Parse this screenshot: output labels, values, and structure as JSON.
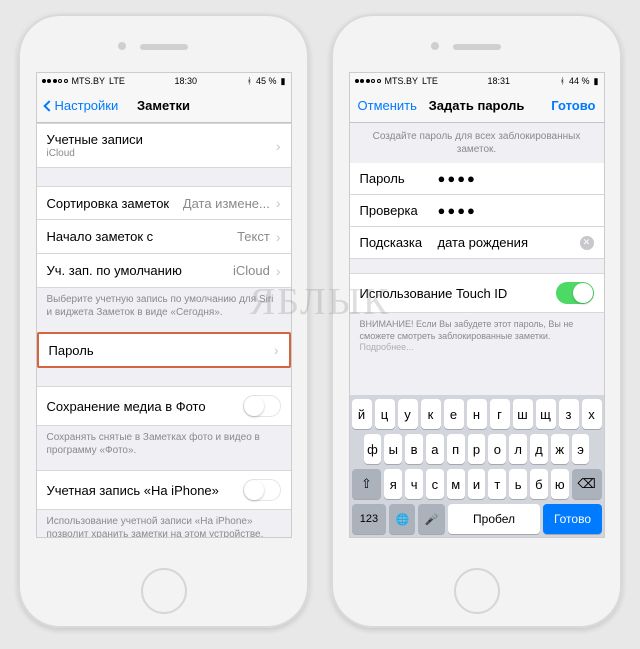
{
  "watermark": "ЯБЛЫК",
  "left": {
    "status": {
      "carrier": "MTS.BY",
      "net": "LTE",
      "time": "18:30",
      "battery": "45 %"
    },
    "nav": {
      "back": "Настройки",
      "title": "Заметки"
    },
    "accounts": {
      "label": "Учетные записи",
      "sub": "iCloud"
    },
    "sort": {
      "label": "Сортировка заметок",
      "value": "Дата измене..."
    },
    "start": {
      "label": "Начало заметок с",
      "value": "Текст"
    },
    "default": {
      "label": "Уч. зап. по умолчанию",
      "value": "iCloud"
    },
    "default_footer": "Выберите учетную запись по умолчанию для Siri и виджета Заметок в виде «Сегодня».",
    "password": {
      "label": "Пароль"
    },
    "savemedia": {
      "label": "Сохранение медиа в Фото"
    },
    "savemedia_footer": "Сохранять снятые в Заметках фото и видео в программу «Фото».",
    "oniphone": {
      "label": "Учетная запись «На iPhone»"
    },
    "oniphone_footer": "Использование учетной записи «На iPhone» позволит хранить заметки на этом устройстве."
  },
  "right": {
    "status": {
      "carrier": "MTS.BY",
      "net": "LTE",
      "time": "18:31",
      "battery": "44 %"
    },
    "nav": {
      "cancel": "Отменить",
      "title": "Задать пароль",
      "done": "Готово"
    },
    "subtitle": "Создайте пароль для всех заблокированных заметок.",
    "fields": {
      "password_label": "Пароль",
      "password_value": "●●●●",
      "verify_label": "Проверка",
      "verify_value": "●●●●",
      "hint_label": "Подсказка",
      "hint_value": "дата рождения"
    },
    "touchid": {
      "label": "Использование Touch ID"
    },
    "warning": "ВНИМАНИЕ! Если Вы забудете этот пароль, Вы не сможете смотреть заблокированные заметки.",
    "warning_link": "Подробнее...",
    "keys": {
      "r1": [
        "й",
        "ц",
        "у",
        "к",
        "е",
        "н",
        "г",
        "ш",
        "щ",
        "з",
        "х"
      ],
      "r2": [
        "ф",
        "ы",
        "в",
        "а",
        "п",
        "р",
        "о",
        "л",
        "д",
        "ж",
        "э"
      ],
      "r3": [
        "я",
        "ч",
        "с",
        "м",
        "и",
        "т",
        "ь",
        "б",
        "ю"
      ],
      "k123": "123",
      "space": "Пробел",
      "return": "Готово"
    }
  }
}
